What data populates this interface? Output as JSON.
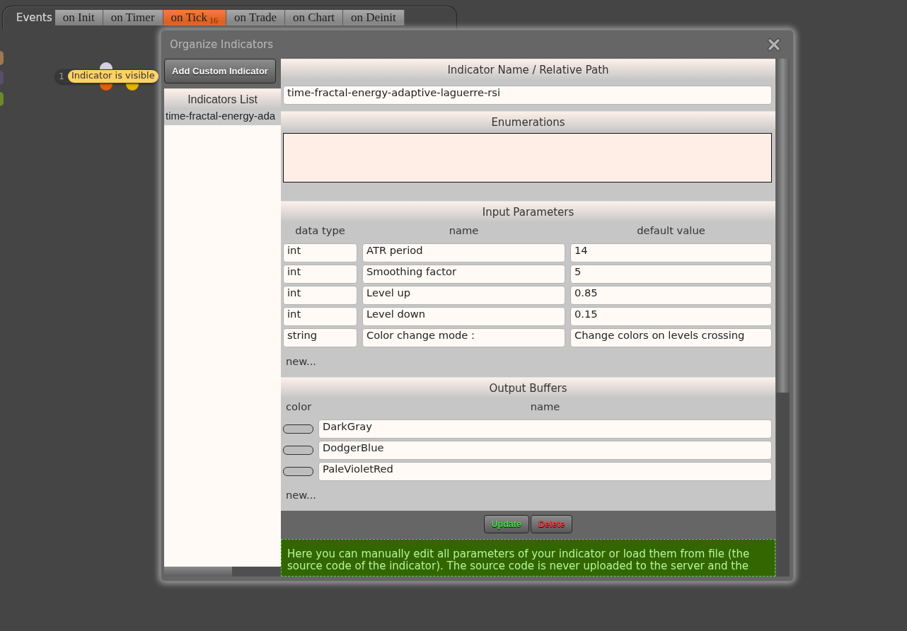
{
  "tab_bar": {
    "label": "Events",
    "tabs": [
      {
        "label": "on Init",
        "selected": false
      },
      {
        "label": "on Timer",
        "selected": false
      },
      {
        "label": "on Tick",
        "count": "16",
        "selected": true
      },
      {
        "label": "on Trade",
        "selected": false
      },
      {
        "label": "on Chart",
        "selected": false
      },
      {
        "label": "on Deinit",
        "selected": false
      }
    ]
  },
  "canvas": {
    "edge_dots": [
      {
        "color": "#a07850"
      },
      {
        "color": "#585068"
      },
      {
        "color": "#6a8a2a"
      }
    ],
    "node": {
      "index": "1",
      "tooltip": "Indicator is visible",
      "dots": [
        {
          "color": "#d8d0e2"
        },
        {
          "color": "#e65c0c"
        },
        {
          "color": "#e6b400"
        }
      ]
    }
  },
  "dialog": {
    "title": "Organize Indicators",
    "add_button": "Add Custom Indicator",
    "list": {
      "title": "Indicators List",
      "items": [
        {
          "label": "time-fractal-energy-ada",
          "selected": true
        }
      ]
    },
    "name_section": {
      "title": "Indicator Name / Relative Path",
      "value": "time-fractal-energy-adaptive-laguerre-rsi"
    },
    "enumerations": {
      "title": "Enumerations"
    },
    "input_parameters": {
      "title": "Input Parameters",
      "columns": [
        "data type",
        "name",
        "default value"
      ],
      "rows": [
        {
          "data_type": "int",
          "name": "ATR period",
          "default_value": "14"
        },
        {
          "data_type": "int",
          "name": "Smoothing factor",
          "default_value": "5"
        },
        {
          "data_type": "int",
          "name": "Level up",
          "default_value": "0.85"
        },
        {
          "data_type": "int",
          "name": "Level down",
          "default_value": "0.15"
        },
        {
          "data_type": "string",
          "name": "Color change mode :",
          "default_value": "Change colors on levels crossing"
        }
      ],
      "new_link": "new..."
    },
    "output_buffers": {
      "title": "Output Buffers",
      "columns": [
        "color",
        "name"
      ],
      "rows": [
        {
          "name": "DarkGray"
        },
        {
          "name": "DodgerBlue"
        },
        {
          "name": "PaleVioletRed"
        }
      ],
      "new_link": "new..."
    },
    "buttons": [
      {
        "label": "Update",
        "kind": "update"
      },
      {
        "label": "Delete",
        "kind": "delete"
      }
    ],
    "info": "Here you can manually edit all parameters of your indicator or load them from file (the source code of the indicator). The source code is never uploaded to the server and the"
  }
}
